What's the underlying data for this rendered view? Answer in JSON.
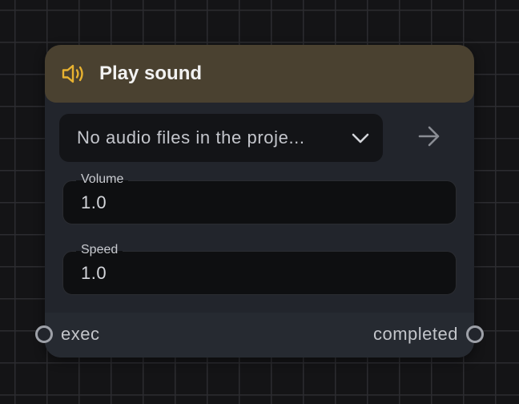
{
  "node": {
    "title": "Play sound",
    "header_icon": "speaker-icon",
    "header_color": "#4a4130",
    "icon_color": "#e8b230",
    "audio_file_select": {
      "value": "No audio files in the proje...",
      "icon": "chevron-down-icon"
    },
    "action_icon": "arrow-right-icon",
    "fields": {
      "volume": {
        "label": "Volume",
        "value": "1.0"
      },
      "speed": {
        "label": "Speed",
        "value": "1.0"
      }
    },
    "ports": {
      "input": {
        "label": "exec"
      },
      "output": {
        "label": "completed"
      }
    }
  }
}
